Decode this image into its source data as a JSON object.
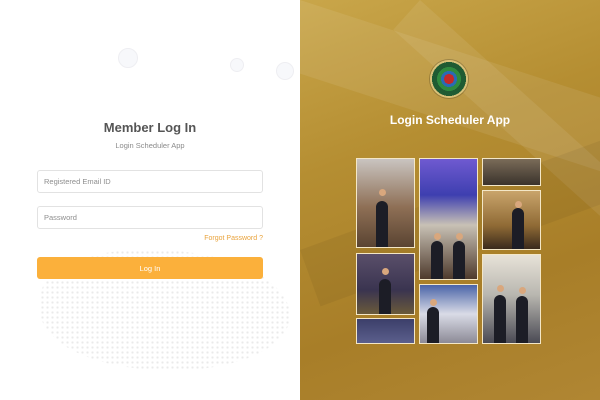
{
  "login": {
    "title": "Member Log In",
    "subtitle": "Login Scheduler App",
    "email_placeholder": "Registered Email ID",
    "password_placeholder": "Password",
    "forgot_label": "Forgot Password ?",
    "submit_label": "Log In"
  },
  "brand": {
    "app_name": "Login Scheduler App",
    "logo_icon": "organization-seal-icon"
  },
  "colors": {
    "accent": "#fbb03b",
    "link": "#e9a33c",
    "panel_gold": "#b58e32"
  }
}
